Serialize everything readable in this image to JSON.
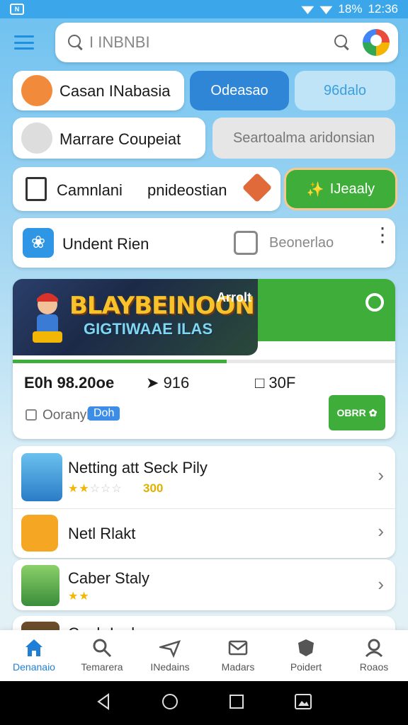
{
  "status_bar": {
    "left_badge": "N",
    "battery": "18%",
    "time": "12:36"
  },
  "search": {
    "placeholder": "I INBNBI"
  },
  "rows": {
    "r1_label": "Casan INabasia",
    "r1_btn1": "Odeasao",
    "r1_btn2": "96dalo",
    "r2_label": "Marrare Coupeiat",
    "r2_btn": "Seartoalma aridonsian",
    "r3_label_a": "Camnlani",
    "r3_label_b": "pnideostian",
    "r3_btn": "IJeaaly",
    "r4_label": "Undent Rien",
    "r4_secondary": "Beonerlao"
  },
  "featured": {
    "banner_title": "BLAYBEINOON",
    "banner_subtitle": "GIGTIWAAE  ILAS",
    "corner_label": "Arrolt",
    "progress_fraction": 0.56,
    "stat_price": "E0h 98.20oe",
    "stat_likes": "916",
    "stat_size": "30F",
    "category": "Ooranyl",
    "tag": "Doh",
    "get_label": "OBRR"
  },
  "list": [
    {
      "title": "Netting att Seck Pily",
      "stars_on": 2,
      "stars_total": 5,
      "rating": "300"
    },
    {
      "title": "Netl Rlakt"
    },
    {
      "title": "Caber Staly",
      "stars_on": 2,
      "stars_total": 2
    }
  ],
  "partial_item_title": "Cnah Inalo",
  "bottom_nav": [
    {
      "label": "Denanaio",
      "icon": "home-icon",
      "active": true
    },
    {
      "label": "Temarera",
      "icon": "search-icon",
      "active": false
    },
    {
      "label": "INedains",
      "icon": "send-icon",
      "active": false
    },
    {
      "label": "Madars",
      "icon": "mail-icon",
      "active": false
    },
    {
      "label": "Poidert",
      "icon": "shield-icon",
      "active": false
    },
    {
      "label": "Roaos",
      "icon": "person-search-icon",
      "active": false
    }
  ],
  "colors": {
    "accent_blue": "#3ba7ea",
    "green": "#3fad3a"
  }
}
